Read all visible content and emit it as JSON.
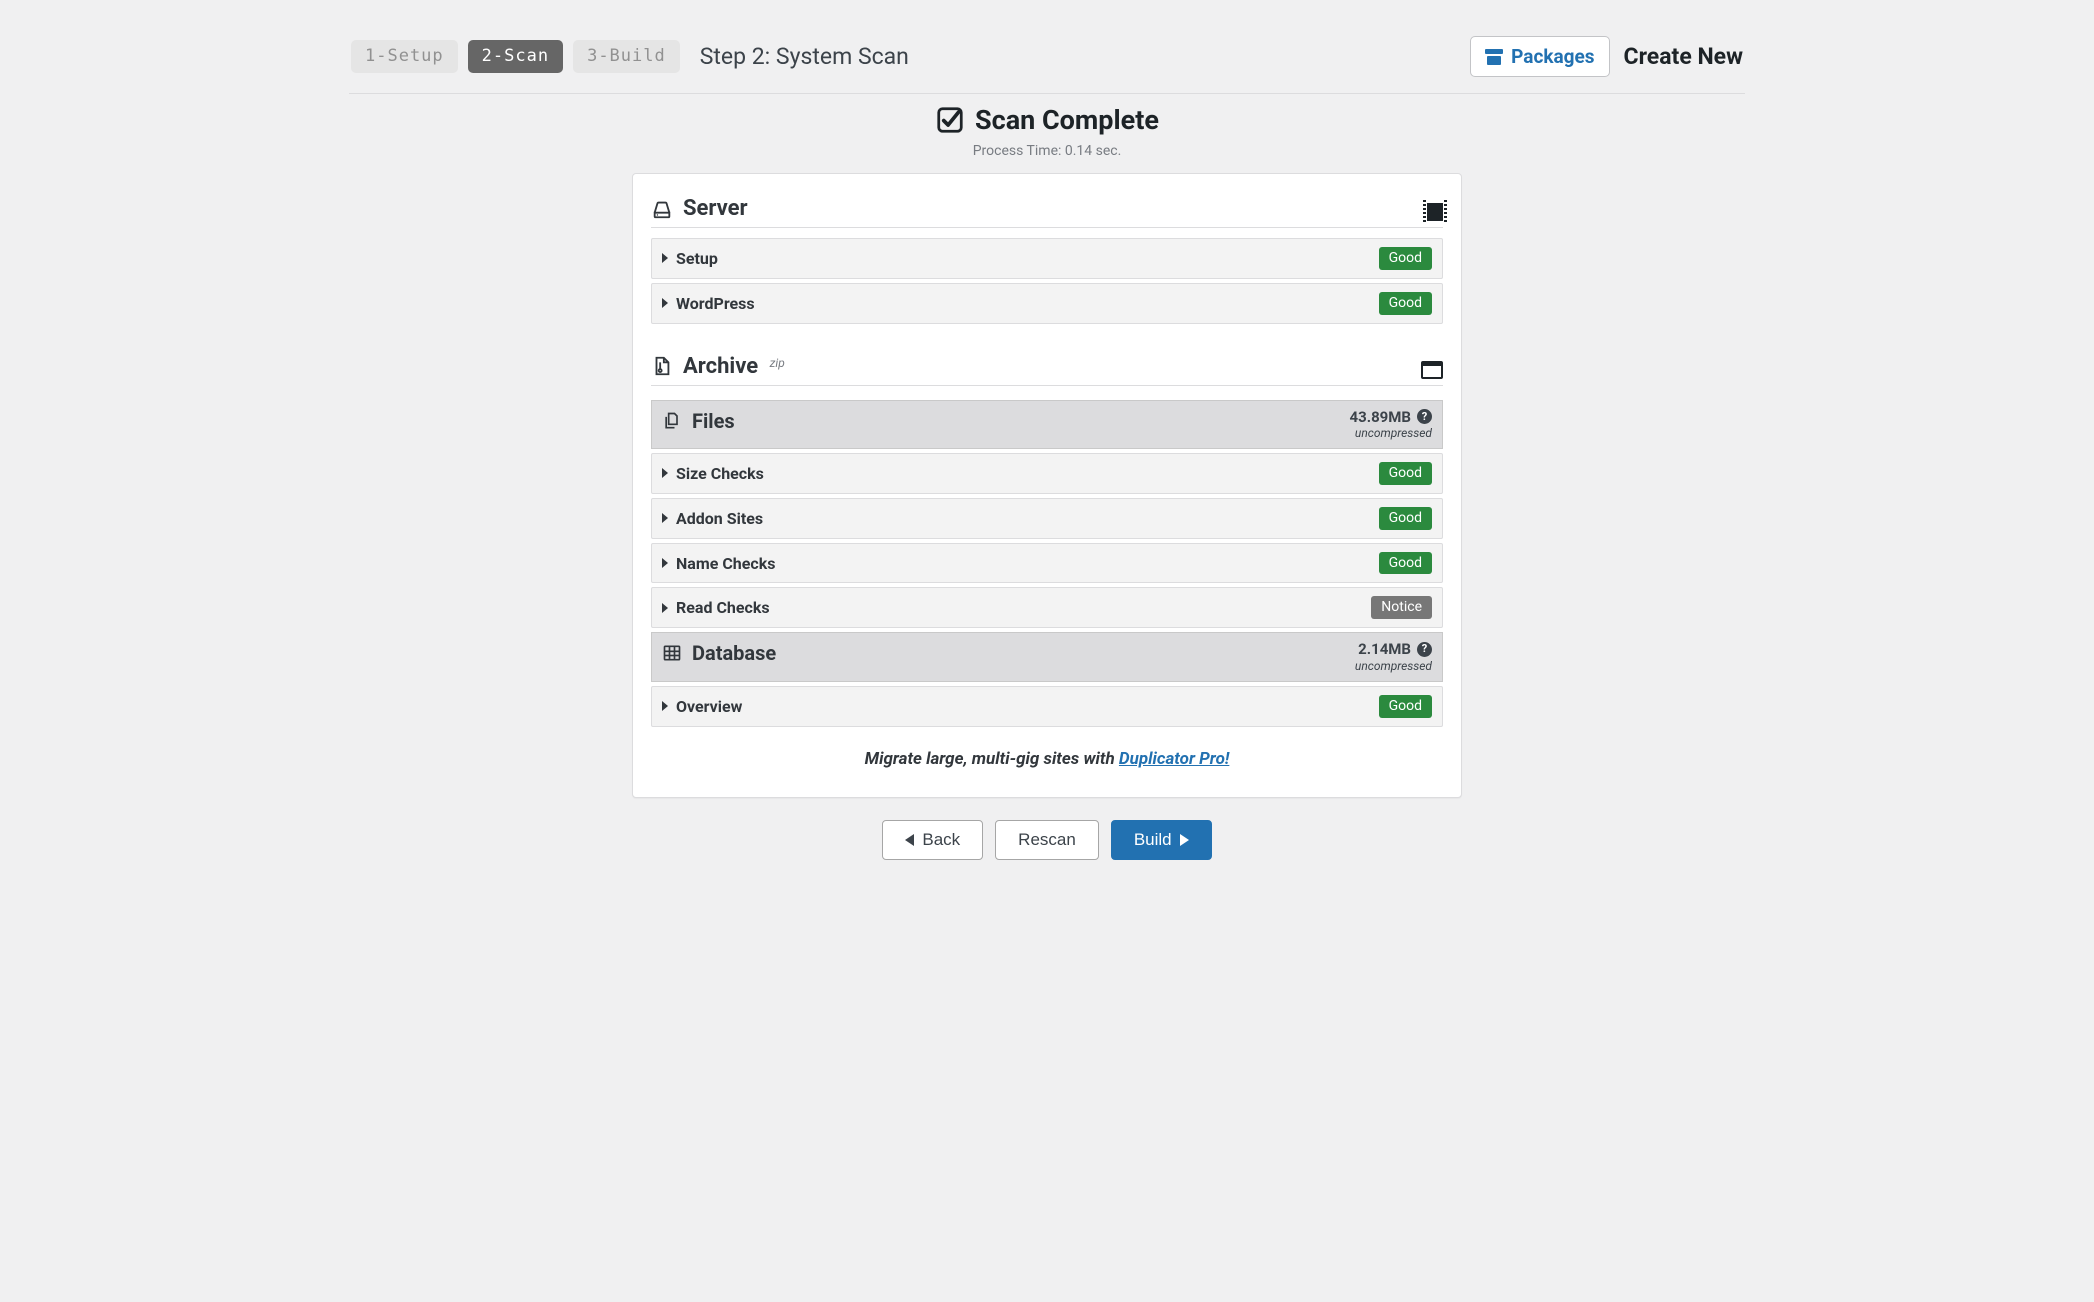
{
  "header": {
    "steps": [
      {
        "label": "1-Setup",
        "state": "inactive"
      },
      {
        "label": "2-Scan",
        "state": "active"
      },
      {
        "label": "3-Build",
        "state": "inactive"
      }
    ],
    "step_title": "Step 2: System Scan",
    "packages_label": "Packages",
    "create_new_label": "Create New"
  },
  "scan": {
    "title": "Scan Complete",
    "process_time_label": "Process Time: 0.14 sec."
  },
  "server": {
    "title": "Server",
    "rows": [
      {
        "label": "Setup",
        "status": "Good",
        "status_kind": "good"
      },
      {
        "label": "WordPress",
        "status": "Good",
        "status_kind": "good"
      }
    ]
  },
  "archive": {
    "title": "Archive",
    "format_sup": "zip",
    "files": {
      "title": "Files",
      "size": "43.89MB",
      "uncompressed_label": "uncompressed",
      "rows": [
        {
          "label": "Size Checks",
          "status": "Good",
          "status_kind": "good"
        },
        {
          "label": "Addon Sites",
          "status": "Good",
          "status_kind": "good"
        },
        {
          "label": "Name Checks",
          "status": "Good",
          "status_kind": "good"
        },
        {
          "label": "Read Checks",
          "status": "Notice",
          "status_kind": "notice"
        }
      ]
    },
    "database": {
      "title": "Database",
      "size": "2.14MB",
      "uncompressed_label": "uncompressed",
      "rows": [
        {
          "label": "Overview",
          "status": "Good",
          "status_kind": "good"
        }
      ]
    }
  },
  "promo": {
    "prefix": "Migrate large, multi-gig sites with ",
    "link_text": "Duplicator Pro!"
  },
  "footer": {
    "back": "Back",
    "rescan": "Rescan",
    "build": "Build"
  }
}
